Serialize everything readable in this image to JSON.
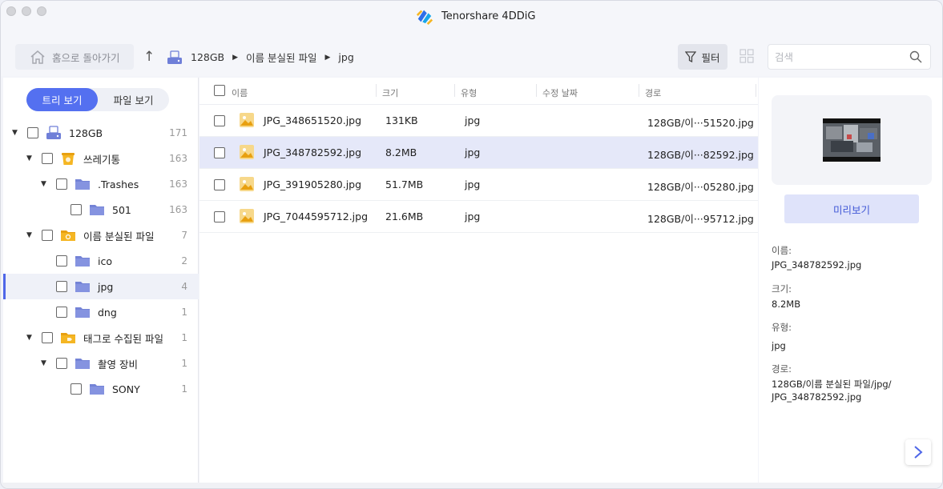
{
  "window": {
    "title": "Tenorshare 4DDiG"
  },
  "toolbar": {
    "home_label": "홈으로 돌아가기",
    "breadcrumb": [
      "128GB",
      "이름 분실된 파일",
      "jpg"
    ],
    "filter_label": "필터",
    "search_placeholder": "검색"
  },
  "sidebar": {
    "tabs": [
      "트리 보기",
      "파일 보기"
    ],
    "active_tab": "트리 보기",
    "tree": [
      {
        "label": "128GB",
        "count": "171",
        "level": 0,
        "expanded": true,
        "icon": "drive-icon"
      },
      {
        "label": "쓰레기통",
        "count": "163",
        "level": 1,
        "expanded": true,
        "icon": "trash-folder-icon"
      },
      {
        "label": ".Trashes",
        "count": "163",
        "level": 2,
        "expanded": true,
        "icon": "folder-icon"
      },
      {
        "label": "501",
        "count": "163",
        "level": 3,
        "icon": "folder-icon"
      },
      {
        "label": "이름 분실된 파일",
        "count": "7",
        "level": 1,
        "expanded": true,
        "icon": "lost-folder-icon"
      },
      {
        "label": "ico",
        "count": "2",
        "level": 2,
        "icon": "folder-icon"
      },
      {
        "label": "jpg",
        "count": "4",
        "level": 2,
        "icon": "folder-icon",
        "selected": true
      },
      {
        "label": "dng",
        "count": "1",
        "level": 2,
        "icon": "folder-icon"
      },
      {
        "label": "태그로 수집된 파일",
        "count": "1",
        "level": 1,
        "expanded": true,
        "icon": "tag-folder-icon"
      },
      {
        "label": "촬영 장비",
        "count": "1",
        "level": 2,
        "expanded": true,
        "icon": "folder-icon"
      },
      {
        "label": "SONY",
        "count": "1",
        "level": 3,
        "icon": "folder-icon"
      }
    ]
  },
  "filelist": {
    "columns": [
      "이름",
      "크기",
      "유형",
      "수정 날짜",
      "경로"
    ],
    "rows": [
      {
        "name": "JPG_348651520.jpg",
        "size": "131KB",
        "type": "jpg",
        "date": "",
        "path": "128GB/이···51520.jpg"
      },
      {
        "name": "JPG_348782592.jpg",
        "size": "8.2MB",
        "type": "jpg",
        "date": "",
        "path": "128GB/이···82592.jpg",
        "selected": true
      },
      {
        "name": "JPG_391905280.jpg",
        "size": "51.7MB",
        "type": "jpg",
        "date": "",
        "path": "128GB/이···05280.jpg"
      },
      {
        "name": "JPG_7044595712.jpg",
        "size": "21.6MB",
        "type": "jpg",
        "date": "",
        "path": "128GB/이···95712.jpg"
      }
    ]
  },
  "preview": {
    "button_label": "미리보기",
    "name_label": "이름:",
    "name_value": "JPG_348782592.jpg",
    "size_label": "크기:",
    "size_value": "8.2MB",
    "type_label": "유형:",
    "type_value": "jpg",
    "path_label": "경로:",
    "path_value": "128GB/이름 분실된 파일/jpg/\nJPG_348782592.jpg"
  },
  "colors": {
    "accent": "#5470f0",
    "selection": "#e5e8f9",
    "folder": "#7483d6",
    "image_file": "#f2c14e"
  }
}
